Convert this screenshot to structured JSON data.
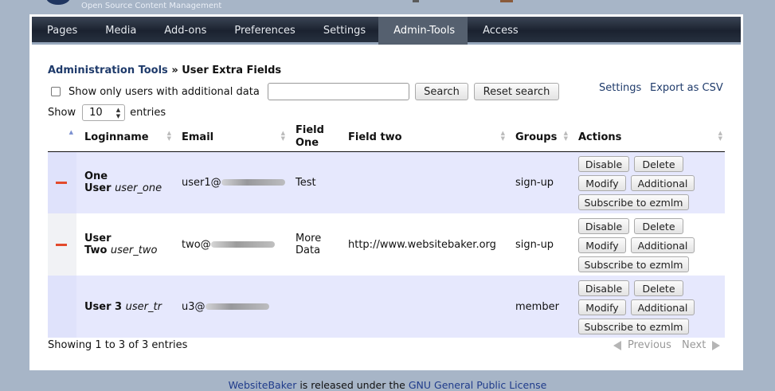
{
  "brand": {
    "tagline": "Open Source Content Management"
  },
  "nav": {
    "items": [
      {
        "label": "Pages"
      },
      {
        "label": "Media"
      },
      {
        "label": "Add-ons"
      },
      {
        "label": "Preferences"
      },
      {
        "label": "Settings"
      },
      {
        "label": "Admin-Tools",
        "active": true
      },
      {
        "label": "Access"
      }
    ]
  },
  "breadcrumb": {
    "parent": "Administration Tools",
    "separator": " » ",
    "current": "User Extra Fields"
  },
  "filter": {
    "checkbox_label": "Show only users with additional data",
    "checkbox_checked": false,
    "search_value": "",
    "search_button": "Search",
    "reset_button": "Reset search"
  },
  "links": {
    "settings": "Settings",
    "export": "Export as CSV"
  },
  "length": {
    "show": "Show",
    "value": "10",
    "entries": "entries"
  },
  "table": {
    "headers": {
      "loginname": "Loginname",
      "email": "Email",
      "field_one_a": "Field",
      "field_one_b": "One",
      "field_two": "Field two",
      "groups": "Groups",
      "actions": "Actions"
    },
    "rows": [
      {
        "marker": true,
        "name_a": "One",
        "name_b": "User",
        "login": "user_one",
        "email_prefix": "user1@",
        "field_one_a": "Test",
        "field_one_b": "",
        "field_two": "",
        "groups": "sign-up"
      },
      {
        "marker": true,
        "name_a": "User",
        "name_b": "Two",
        "login": "user_two",
        "email_prefix": "two@",
        "field_one_a": "More",
        "field_one_b": "Data",
        "field_two": "http://www.websitebaker.org",
        "groups": "sign-up"
      },
      {
        "marker": false,
        "name_a": "",
        "name_b": "User 3",
        "login": "user_tr",
        "email_prefix": "u3@",
        "field_one_a": "",
        "field_one_b": "",
        "field_two": "",
        "groups": "member"
      }
    ],
    "actions": {
      "disable": "Disable",
      "delete": "Delete",
      "modify": "Modify",
      "additional": "Additional",
      "subscribe": "Subscribe to ezmlm"
    }
  },
  "info": "Showing 1 to 3 of 3 entries",
  "pager": {
    "previous": "Previous",
    "next": "Next"
  },
  "footer": {
    "brand": "WebsiteBaker",
    "middle": " is released under the ",
    "license": "GNU General Public License"
  },
  "colors": {
    "nav_bg": "#1b2230",
    "accent_link": "#1f3b6b",
    "row_highlight": "#e6e8fd",
    "delete_marker": "#e34a2c"
  }
}
